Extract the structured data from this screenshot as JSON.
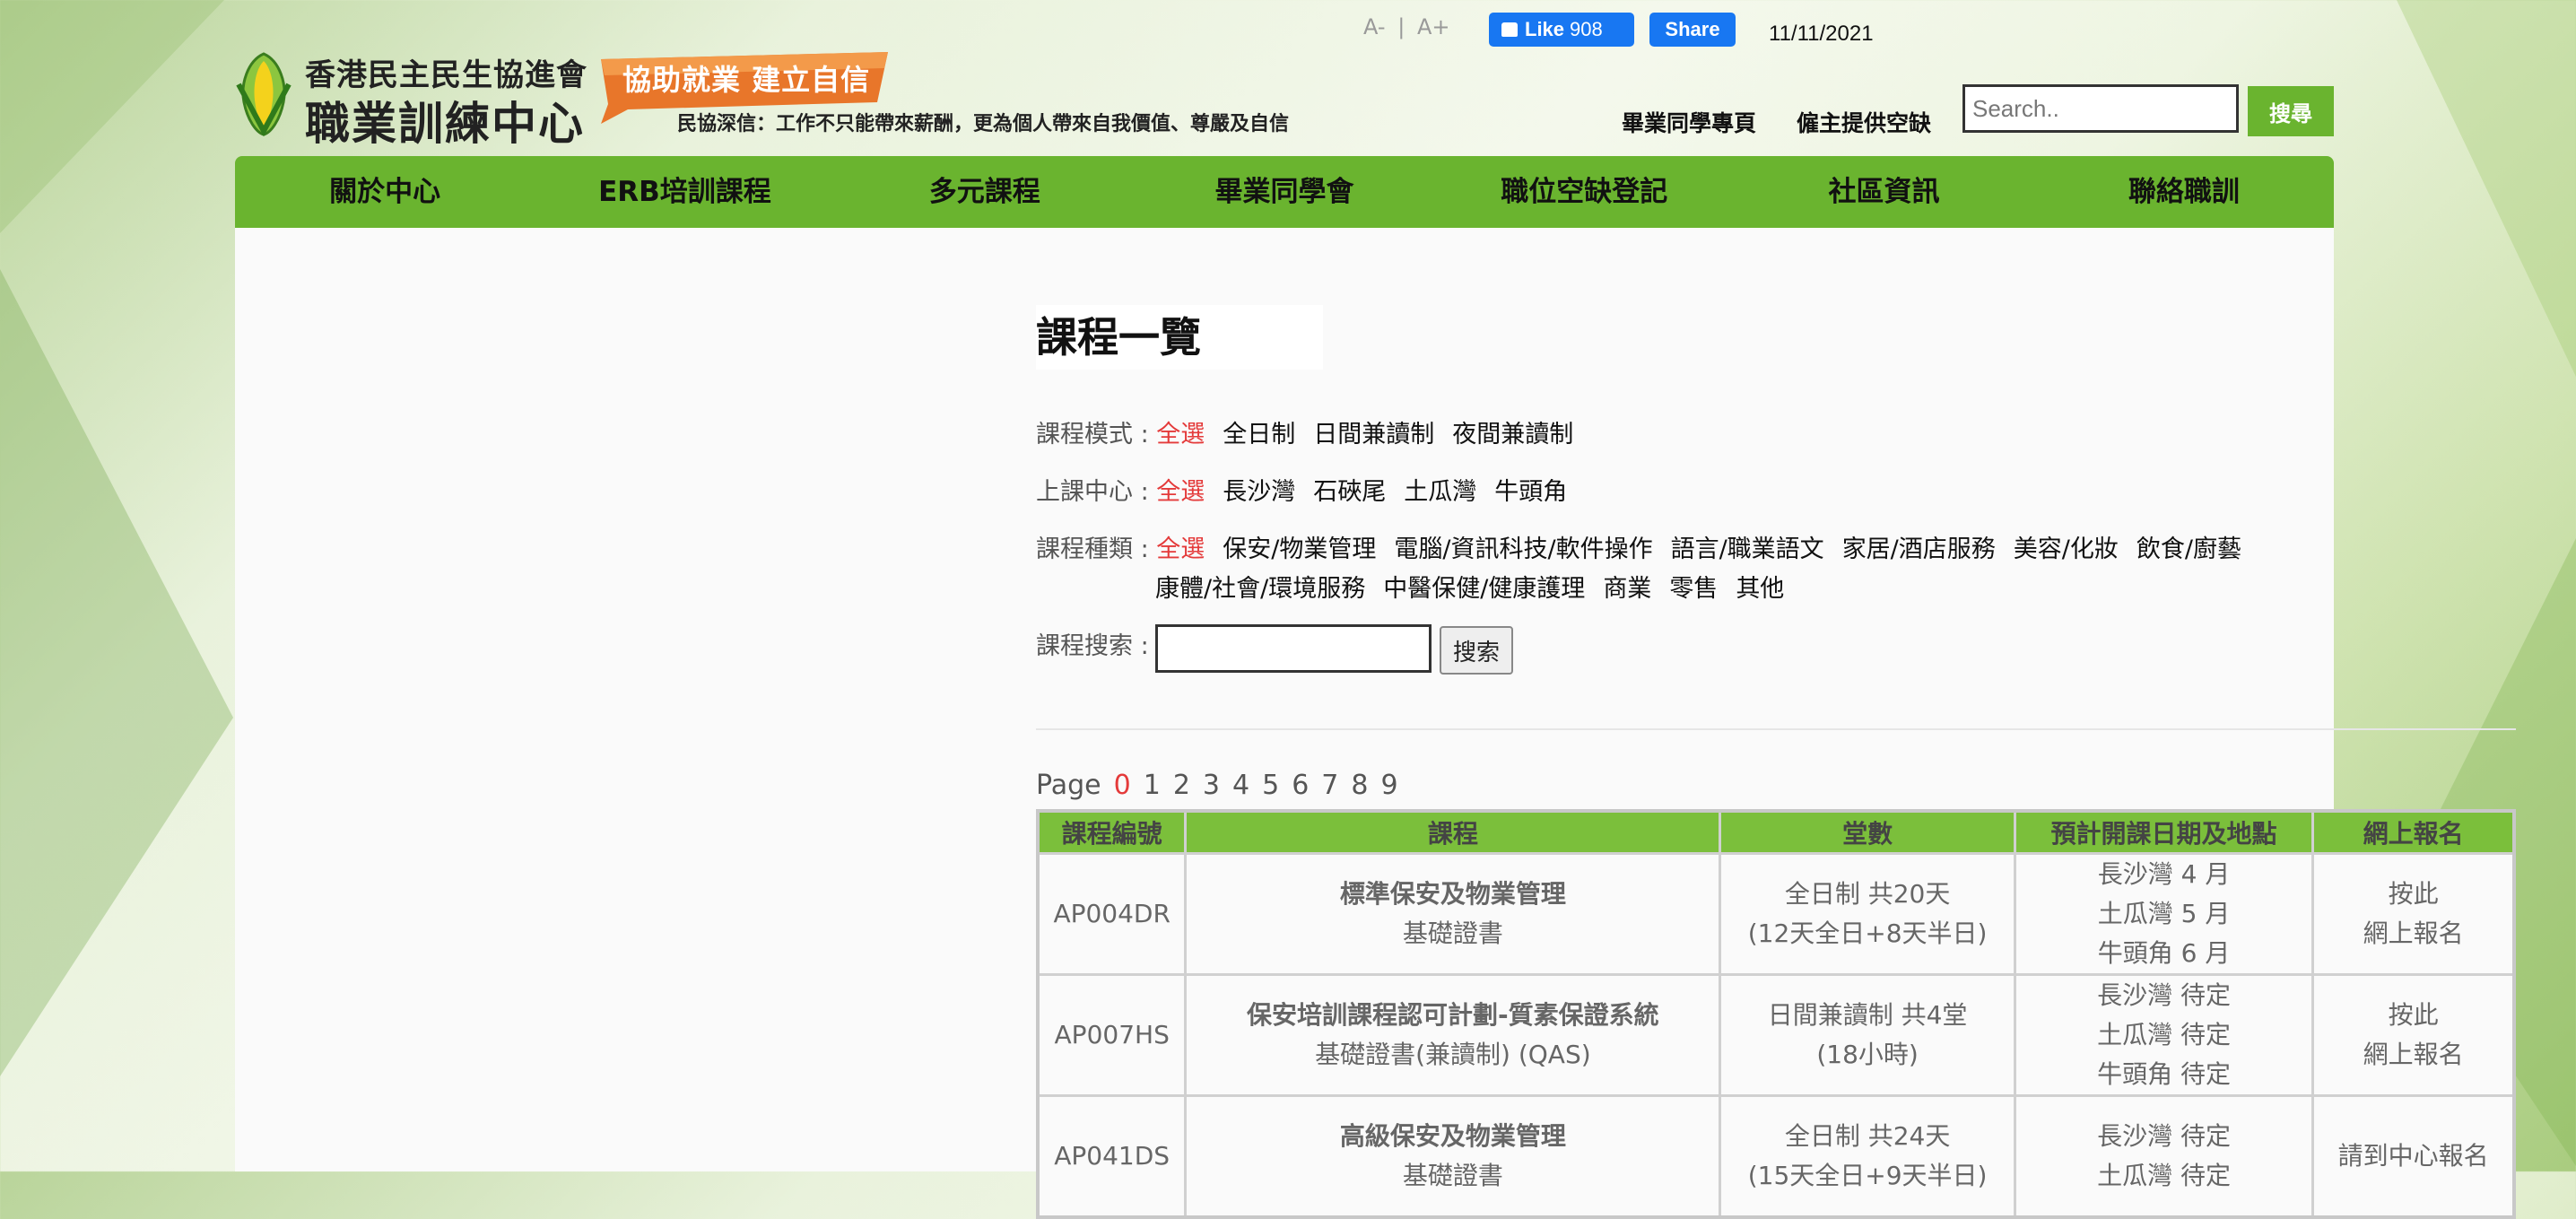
{
  "header": {
    "font_minus": "A-",
    "font_sep": "|",
    "font_plus": "A+",
    "fb_like_label": "Like",
    "fb_like_count": "908",
    "fb_share_label": "Share",
    "date": "11/11/2021",
    "logo_line1": "香港民主民生協進會",
    "logo_line2": "職業訓練中心",
    "banner": "協助就業 建立自信",
    "slogan": "民協深信：工作不只能帶來薪酬，更為個人帶來自我價值、尊嚴及自信",
    "link_alumni_page": "畢業同學專頁",
    "link_employer": "僱主提供空缺",
    "search_placeholder": "Search..",
    "search_button": "搜尋"
  },
  "nav": [
    "關於中心",
    "ERB培訓課程",
    "多元課程",
    "畢業同學會",
    "職位空缺登記",
    "社區資訊",
    "聯絡職訓"
  ],
  "page_title": "課程一覽",
  "filters": {
    "mode": {
      "label": "課程模式 : ",
      "options": [
        "全選",
        "全日制",
        "日間兼讀制",
        "夜間兼讀制"
      ]
    },
    "center": {
      "label": "上課中心 : ",
      "options": [
        "全選",
        "長沙灣",
        "石硤尾",
        "土瓜灣",
        "牛頭角"
      ]
    },
    "category": {
      "label": "課程種類 : ",
      "options_line1": [
        "全選",
        "保安/物業管理",
        "電腦/資訊科技/軟件操作",
        "語言/職業語文",
        "家居/酒店服務",
        "美容/化妝",
        "飲食/廚藝"
      ],
      "options_line2": [
        "康體/社會/環境服務",
        "中醫保健/健康護理",
        "商業",
        "零售",
        "其他"
      ]
    },
    "search": {
      "label": "課程搜索 : ",
      "button": "搜索"
    }
  },
  "pager": {
    "label": "Page",
    "pages": [
      "0",
      "1",
      "2",
      "3",
      "4",
      "5",
      "6",
      "7",
      "8",
      "9"
    ],
    "current": "0"
  },
  "table": {
    "headers": [
      "課程編號",
      "課程",
      "堂數",
      "預計開課日期及地點",
      "網上報名"
    ],
    "rows": [
      {
        "code": "AP004DR",
        "name": "標準保安及物業管理",
        "sub": "基礎證書",
        "sessions1": "全日制 共20天",
        "sessions2": "(12天全日+8天半日)",
        "dates": [
          "長沙灣  4 月",
          "土瓜灣  5 月",
          "牛頭角  6 月"
        ],
        "apply1": "按此",
        "apply2": "網上報名"
      },
      {
        "code": "AP007HS",
        "name": "保安培訓課程認可計劃-質素保證系統",
        "sub": "基礎證書(兼讀制) (QAS)",
        "sessions1": "日間兼讀制 共4堂",
        "sessions2": "(18小時)",
        "dates": [
          "長沙灣  待定",
          "土瓜灣  待定",
          "牛頭角  待定"
        ],
        "apply1": "按此",
        "apply2": "網上報名"
      },
      {
        "code": "AP041DS",
        "name": "高級保安及物業管理",
        "sub": "基礎證書",
        "sessions1": "全日制 共24天",
        "sessions2": "(15天全日+9天半日)",
        "dates": [
          "長沙灣  待定",
          "土瓜灣  待定"
        ],
        "apply1": "請到中心報名",
        "apply2": ""
      }
    ]
  },
  "colors": {
    "brand_green": "#6ab42f",
    "selected_red": "#e43a3a",
    "facebook_blue": "#1877f2"
  }
}
